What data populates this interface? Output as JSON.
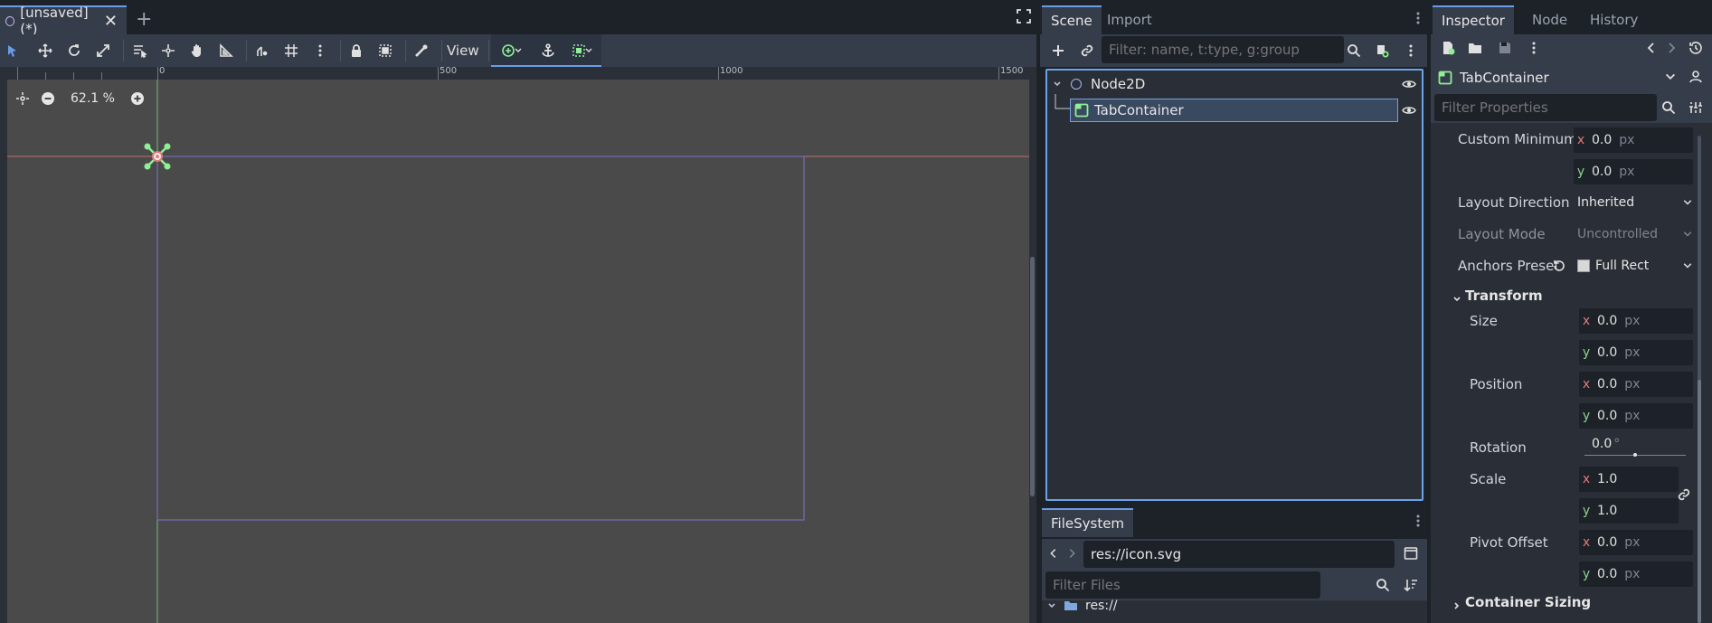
{
  "viewport": {
    "tab_label": "[unsaved](*)",
    "add_tab_symbol": "+",
    "view_menu_label": "View",
    "zoom_level": "62.1 %",
    "ruler_labels": [
      "0",
      "500",
      "1000",
      "1500"
    ]
  },
  "scene_dock": {
    "tabs": [
      {
        "label": "Scene"
      },
      {
        "label": "Import"
      }
    ],
    "filter_placeholder": "Filter: name, t:type, g:group",
    "nodes": [
      {
        "name": "Node2D",
        "type": "Node2D"
      },
      {
        "name": "TabContainer",
        "type": "TabContainer"
      }
    ]
  },
  "filesystem_dock": {
    "tab_label": "FileSystem",
    "path": "res://icon.svg",
    "filter_placeholder": "Filter Files",
    "root_item": "res://"
  },
  "inspector": {
    "tabs": [
      {
        "label": "Inspector"
      },
      {
        "label": "Node"
      },
      {
        "label": "History"
      }
    ],
    "object_name": "TabContainer",
    "filter_placeholder": "Filter Properties",
    "properties": {
      "custom_minimum": {
        "label": "Custom Minimum",
        "x": "0.0",
        "y": "0.0",
        "unit": "px"
      },
      "layout_direction": {
        "label": "Layout Direction",
        "value": "Inherited"
      },
      "layout_mode": {
        "label": "Layout Mode",
        "value": "Uncontrolled"
      },
      "anchors_preset": {
        "label": "Anchors Preset",
        "value": "Full Rect"
      }
    },
    "transform": {
      "section_label": "Transform",
      "size": {
        "label": "Size",
        "x": "0.0",
        "y": "0.0",
        "unit": "px"
      },
      "position": {
        "label": "Position",
        "x": "0.0",
        "y": "0.0",
        "unit": "px"
      },
      "rotation": {
        "label": "Rotation",
        "value": "0.0",
        "unit": "°"
      },
      "scale": {
        "label": "Scale",
        "x": "1.0",
        "y": "1.0"
      },
      "pivot_offset": {
        "label": "Pivot Offset",
        "x": "0.0",
        "y": "0.0",
        "unit": "px"
      }
    },
    "container_sizing_label": "Container Sizing",
    "axis_x": "x",
    "axis_y": "y"
  },
  "colors": {
    "accent": "#699ce8",
    "node2d": "#a5b7f3",
    "control": "#8eef97",
    "axis_x": "#e27a7a",
    "axis_y": "#8fd08f"
  }
}
